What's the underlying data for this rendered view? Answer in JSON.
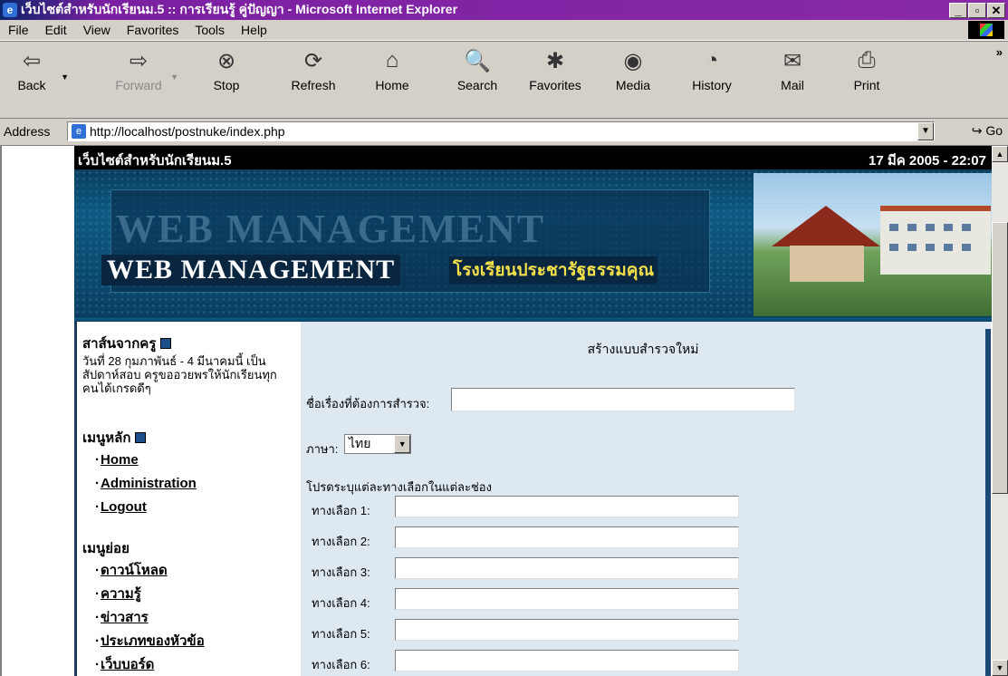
{
  "window": {
    "title": "เว็บไซต์สำหรับนักเรียนม.5 :: การเรียนรู้ คู่ปัญญา - Microsoft Internet Explorer",
    "controls": [
      "_",
      "▫",
      "✕"
    ]
  },
  "menu": [
    "File",
    "Edit",
    "View",
    "Favorites",
    "Tools",
    "Help"
  ],
  "toolbar": {
    "buttons": [
      {
        "label": "Back",
        "icon": "back-arrow-icon",
        "glyph": "⇦"
      },
      {
        "label": "Forward",
        "icon": "forward-arrow-icon",
        "glyph": "⇨"
      },
      {
        "label": "Stop",
        "icon": "stop-icon",
        "glyph": "⊗"
      },
      {
        "label": "Refresh",
        "icon": "refresh-icon",
        "glyph": "⟳"
      },
      {
        "label": "Home",
        "icon": "home-icon",
        "glyph": "⌂"
      },
      {
        "label": "Search",
        "icon": "search-icon",
        "glyph": "🔍"
      },
      {
        "label": "Favorites",
        "icon": "favorites-icon",
        "glyph": "✱"
      },
      {
        "label": "Media",
        "icon": "media-icon",
        "glyph": "◉"
      },
      {
        "label": "History",
        "icon": "history-icon",
        "glyph": "◔"
      },
      {
        "label": "Mail",
        "icon": "mail-icon",
        "glyph": "✉"
      },
      {
        "label": "Print",
        "icon": "print-icon",
        "glyph": "⎙"
      }
    ],
    "more": "»"
  },
  "address": {
    "label": "Address",
    "url": "http://localhost/postnuke/index.php",
    "go": "Go"
  },
  "site": {
    "name": "เว็บไซต์สำหรับนักเรียนม.5",
    "date": "17 มีค 2005 - 22:07",
    "banner_ghost": "WEB MANAGEMENT",
    "banner_title": "WEB MANAGEMENT",
    "school": "โรงเรียนประชารัฐธรรมคุณ"
  },
  "sidebar": {
    "notice_title": "สาส์นจากครู",
    "notice_text": "วันที่ 28 กุมภาพันธ์ - 4 มีนาคมนี้ เป็นสัปดาห์สอบ ครูขออวยพรให้นักเรียนทุกคนได้เกรดดีๆ",
    "main_menu_title": "เมนูหลัก",
    "main_menu": [
      "Home",
      "Administration",
      "Logout"
    ],
    "sub_menu_title": "เมนูย่อย",
    "sub_menu": [
      "ดาวน์โหลด",
      "ความรู้",
      "ข่าวสาร",
      "ประเภทของหัวข้อ",
      "เว็บบอร์ด"
    ]
  },
  "form": {
    "heading": "สร้างแบบสำรวจใหม่",
    "topic_label": "ชื่อเรื่องที่ต้องการสำรวจ:",
    "topic_value": "",
    "language_label": "ภาษา:",
    "language_value": "ไทย",
    "instructions": "โปรดระบุแต่ละทางเลือกในแต่ละช่อง",
    "options": [
      "ทางเลือก 1:",
      "ทางเลือก 2:",
      "ทางเลือก 3:",
      "ทางเลือก 4:",
      "ทางเลือก 5:",
      "ทางเลือก 6:"
    ]
  }
}
